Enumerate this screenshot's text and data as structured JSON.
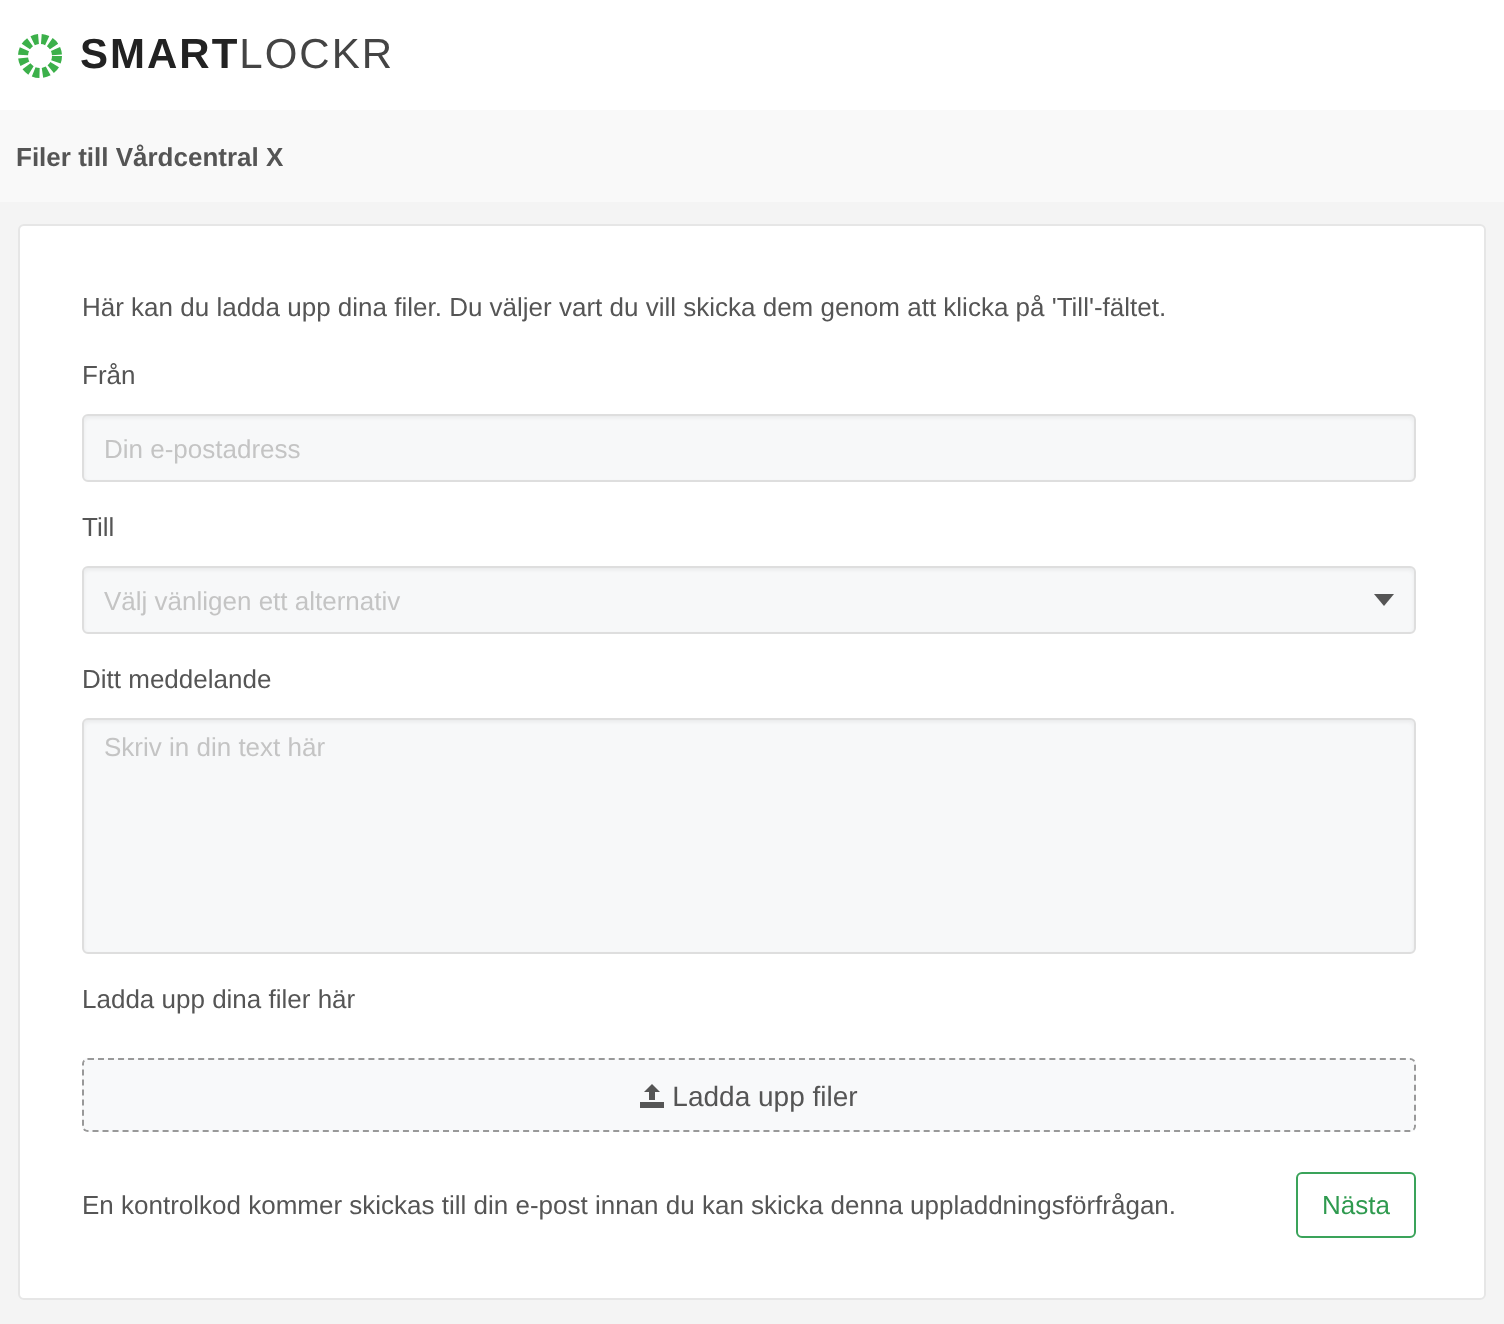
{
  "logo": {
    "text": "**SMART**LOCKR"
  },
  "header": {
    "title": "Filer till Vårdcentral X"
  },
  "form": {
    "intro": "Här kan du ladda upp dina filer. Du väljer vart du vill skicka dem genom att klicka på 'Till'-fältet.",
    "fields": [
      {
        "kind": "input",
        "label": "Från",
        "placeholder": "Din e-postadress"
      },
      {
        "kind": "select",
        "label": "Till",
        "placeholder": "Välj vänligen ett alternativ"
      },
      {
        "kind": "textarea",
        "label": "Ditt meddelande",
        "placeholder": "Skriv in din text här"
      }
    ],
    "upload": {
      "label": "Ladda upp dina filer här",
      "button": "Ladda upp filer"
    },
    "footer_note": "En kontrolkod kommer skickas till din e-post innan du kan skicka denna uppladdningsförfrågan.",
    "next_button": "Nästa"
  }
}
